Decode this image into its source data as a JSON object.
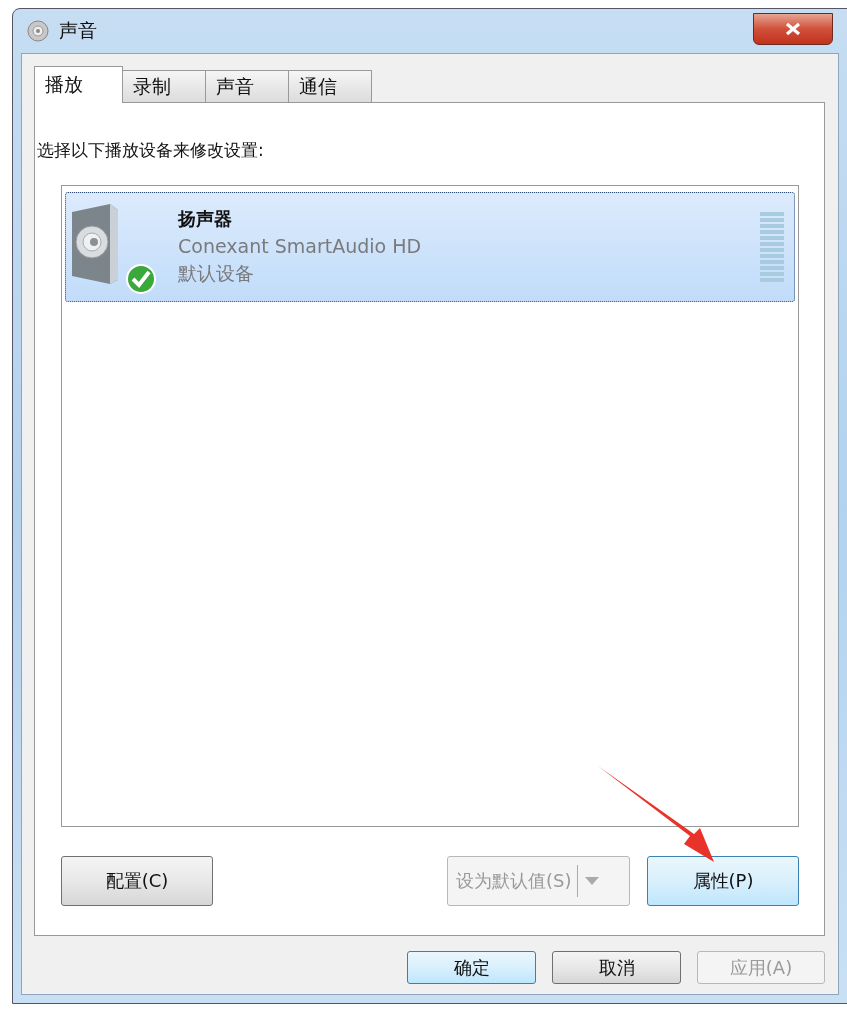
{
  "window": {
    "title": "声音"
  },
  "tabs": [
    {
      "label": "播放",
      "selected": true
    },
    {
      "label": "录制",
      "selected": false
    },
    {
      "label": "声音",
      "selected": false
    },
    {
      "label": "通信",
      "selected": false
    }
  ],
  "instruction": "选择以下播放设备来修改设置:",
  "devices": [
    {
      "name": "扬声器",
      "driver": "Conexant SmartAudio HD",
      "status": "默认设备",
      "selected": true,
      "default": true
    }
  ],
  "panel_buttons": [
    {
      "kind": "button",
      "label": "配置(C)",
      "disabled": false,
      "focused": false
    },
    {
      "kind": "split",
      "label": "设为默认值(S)",
      "disabled": true,
      "focused": false
    },
    {
      "kind": "button",
      "label": "属性(P)",
      "disabled": false,
      "focused": true
    }
  ],
  "dialog_buttons": [
    {
      "label": "确定",
      "disabled": false,
      "focused": true
    },
    {
      "label": "取消",
      "disabled": false,
      "focused": false
    },
    {
      "label": "应用(A)",
      "disabled": true,
      "focused": false
    }
  ]
}
